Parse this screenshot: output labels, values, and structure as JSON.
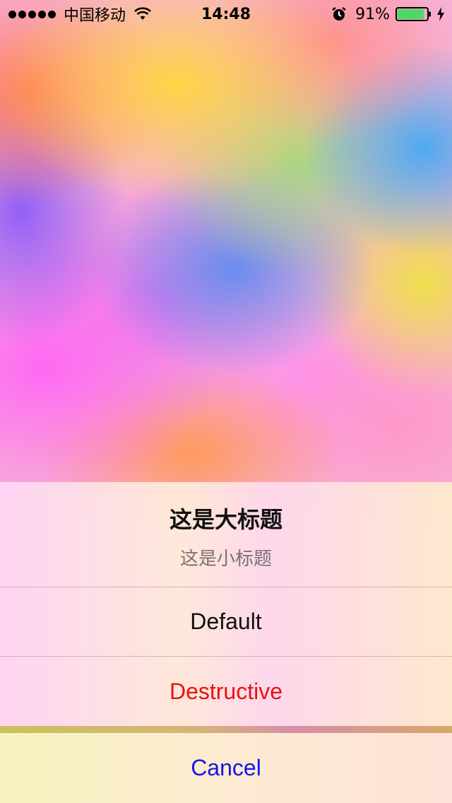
{
  "status_bar": {
    "carrier": "中国移动",
    "time": "14:48",
    "battery_percent": "91%",
    "battery_level": 0.91,
    "icons": [
      "signal-dots-icon",
      "wifi-icon",
      "alarm-icon",
      "battery-icon",
      "charging-bolt-icon"
    ]
  },
  "action_sheet": {
    "title": "这是大标题",
    "subtitle": "这是小标题",
    "buttons": [
      {
        "label": "Default",
        "style": "default",
        "color": "#111111"
      },
      {
        "label": "Destructive",
        "style": "destructive",
        "color": "#e8120f"
      }
    ],
    "cancel": {
      "label": "Cancel",
      "color": "#1616e6"
    }
  },
  "colors": {
    "battery_fill": "#4cd964",
    "destructive": "#e8120f",
    "cancel": "#1616e6"
  }
}
